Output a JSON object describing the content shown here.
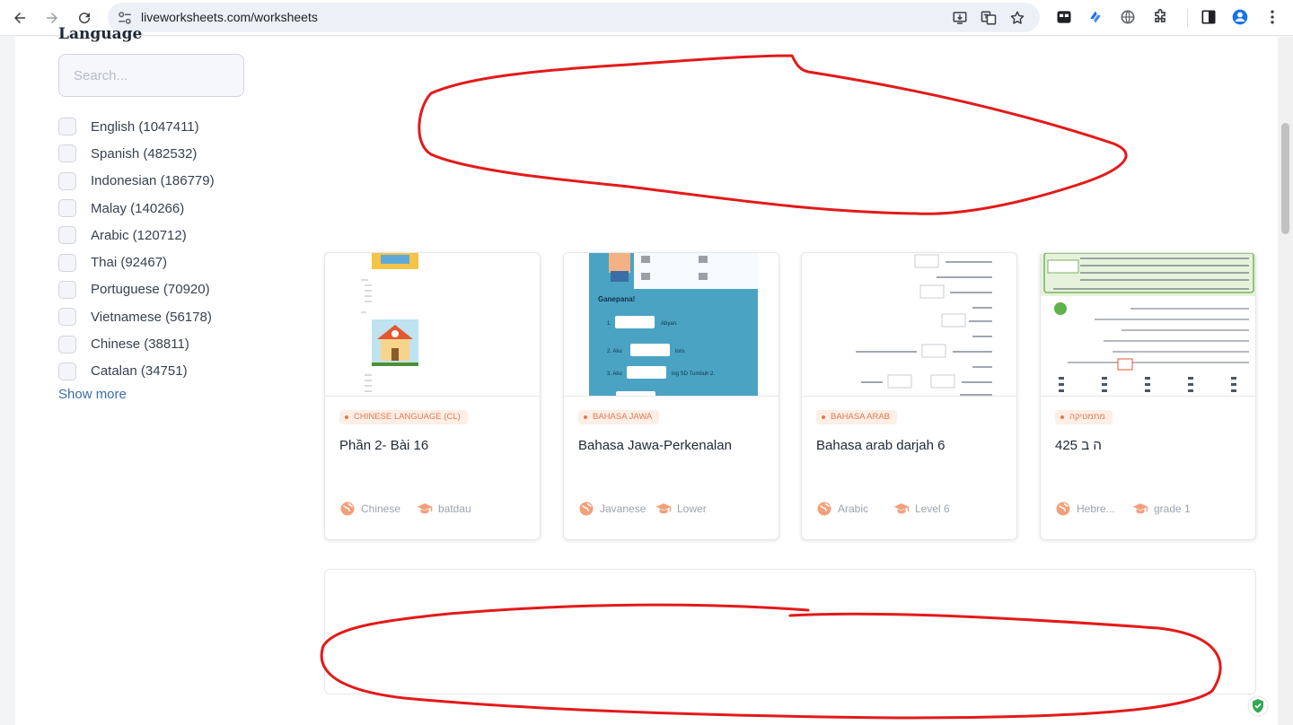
{
  "browser": {
    "url": "liveworksheets.com/worksheets"
  },
  "sidebar": {
    "heading": "Language",
    "search_placeholder": "Search...",
    "languages": [
      {
        "label": "English (1047411)"
      },
      {
        "label": "Spanish (482532)"
      },
      {
        "label": "Indonesian (186779)"
      },
      {
        "label": "Malay (140266)"
      },
      {
        "label": "Arabic (120712)"
      },
      {
        "label": "Thai (92467)"
      },
      {
        "label": "Portuguese (70920)"
      },
      {
        "label": "Vietnamese (56178)"
      },
      {
        "label": "Chinese (38811)"
      },
      {
        "label": "Catalan (34751)"
      }
    ],
    "show_more": "Show more"
  },
  "cards": [
    {
      "badge": "CHINESE LANGUAGE (CL)",
      "title": "Phần 2- Bài 16",
      "language": "Chinese",
      "level": "batdau"
    },
    {
      "badge": "BAHASA JAWA",
      "title": "Bahasa Jawa-Perkenalan",
      "language": "Javanese",
      "level": "Lower"
    },
    {
      "badge": "BAHASA ARAB",
      "title": "Bahasa arab darjah 6",
      "language": "Arabic",
      "level": "Level 6"
    },
    {
      "badge": "מתמטיקה",
      "title": "425 ה ב",
      "language": "Hebre...",
      "level": "grade 1"
    }
  ],
  "thumbs": {
    "javanese_heading": "Ganepana!",
    "javanese_lines": [
      "1.",
      "Abyan.",
      "2.  Aku",
      "loro.",
      "3. Aku",
      "ing SD Tumbuh 2."
    ]
  },
  "colors": {
    "accent": "#e07b52",
    "badge_bg": "#fdeee6",
    "link": "#3b6ea5",
    "annotation": "#e31a1a"
  }
}
